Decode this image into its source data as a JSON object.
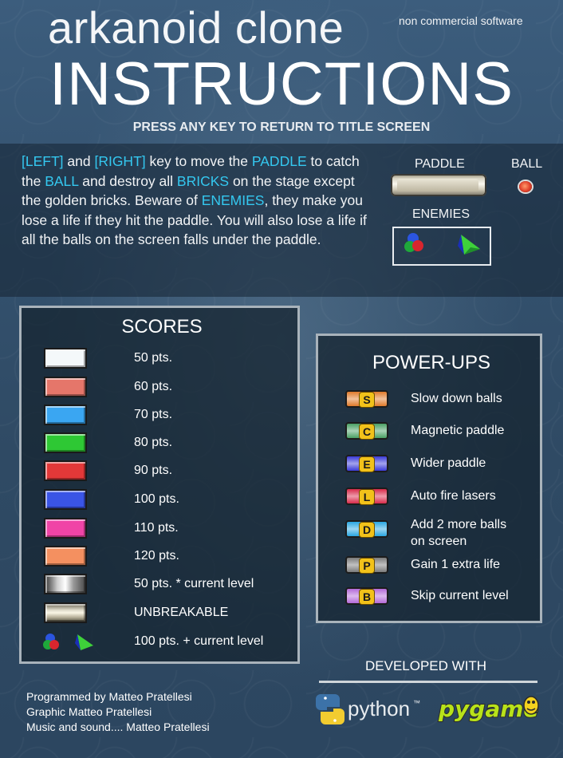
{
  "header": {
    "game_title": "arkanoid clone",
    "license_note": "non commercial software",
    "screen_title": "INSTRUCTIONS",
    "prompt": "PRESS ANY KEY TO RETURN TO TITLE SCREEN"
  },
  "instructions": {
    "parts": [
      {
        "text": "[LEFT]",
        "hl": true
      },
      {
        "text": " and ",
        "hl": false
      },
      {
        "text": "[RIGHT]",
        "hl": true
      },
      {
        "text": " key to move the ",
        "hl": false
      },
      {
        "text": "PADDLE",
        "hl": true
      },
      {
        "text": " to catch the ",
        "hl": false
      },
      {
        "text": "BALL",
        "hl": true
      },
      {
        "text": " and destroy all ",
        "hl": false
      },
      {
        "text": "BRICKS",
        "hl": true
      },
      {
        "text": " on the stage except the golden bricks. ",
        "hl": false
      },
      {
        "text": "Beware of ",
        "hl": false
      },
      {
        "text": "ENEMIES",
        "hl": true
      },
      {
        "text": ", they make you lose a life if they hit the paddle. You will also lose a life if all the balls on the screen falls under the paddle.",
        "hl": false
      }
    ],
    "highlight_color": "#34c8f0"
  },
  "legend": {
    "paddle_label": "PADDLE",
    "ball_label": "BALL",
    "enemies_label": "ENEMIES"
  },
  "scores": {
    "title": "SCORES",
    "rows": [
      {
        "label": "50 pts.",
        "color": "#f4f8fa"
      },
      {
        "label": "60 pts.",
        "color": "#e5766a"
      },
      {
        "label": "70 pts.",
        "color": "#3aa6f2"
      },
      {
        "label": "80 pts.",
        "color": "#2ec834"
      },
      {
        "label": "90 pts.",
        "color": "#e33838"
      },
      {
        "label": "100 pts.",
        "color": "#3a54e6"
      },
      {
        "label": "110 pts.",
        "color": "#f044a6"
      },
      {
        "label": "120 pts.",
        "color": "#f49060"
      },
      {
        "label": "50 pts. *  current level",
        "color": "silver"
      },
      {
        "label": "UNBREAKABLE",
        "color": "gold"
      },
      {
        "label": "100 pts. + current level",
        "color": "enemies"
      }
    ]
  },
  "powerups": {
    "title": "POWER-UPS",
    "items": [
      {
        "letter": "S",
        "label": "Slow down balls",
        "color": "#e07a2a"
      },
      {
        "letter": "C",
        "label": "Magnetic paddle",
        "color": "#4aa064"
      },
      {
        "letter": "E",
        "label": "Wider paddle",
        "color": "#3a3ad8"
      },
      {
        "letter": "L",
        "label": "Auto fire lasers",
        "color": "#d82a4a"
      },
      {
        "letter": "D",
        "label": "Add 2 more balls\non screen",
        "color": "#2aa6e0"
      },
      {
        "letter": "P",
        "label": "Gain 1 extra life",
        "color": "#7a7a7a"
      },
      {
        "letter": "B",
        "label": "Skip current level",
        "color": "#b46ad8"
      }
    ]
  },
  "footer": {
    "developed_with": "DEVELOPED WITH",
    "python_text": "python",
    "python_tm": "™",
    "pygame_text": "pygame",
    "credits": [
      "Programmed by Matteo Pratellesi",
      "Graphic Matteo Pratellesi",
      "Music and sound.... Matteo Pratellesi"
    ]
  }
}
